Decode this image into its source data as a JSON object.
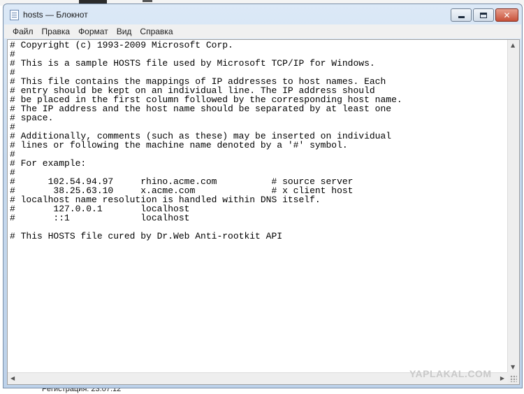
{
  "window": {
    "title": "hosts — Блокнот",
    "icon": "notepad-icon"
  },
  "caption_buttons": {
    "minimize_icon": "minimize-icon",
    "maximize_icon": "maximize-icon",
    "close_icon": "close-icon",
    "close_glyph": "✕",
    "close_color": "#c7513a"
  },
  "menu": [
    {
      "label": "Файл"
    },
    {
      "label": "Правка"
    },
    {
      "label": "Формат"
    },
    {
      "label": "Вид"
    },
    {
      "label": "Справка"
    }
  ],
  "editor": {
    "lines": [
      "# Copyright (c) 1993-2009 Microsoft Corp.",
      "#",
      "# This is a sample HOSTS file used by Microsoft TCP/IP for Windows.",
      "#",
      "# This file contains the mappings of IP addresses to host names. Each",
      "# entry should be kept on an individual line. The IP address should",
      "# be placed in the first column followed by the corresponding host name.",
      "# The IP address and the host name should be separated by at least one",
      "# space.",
      "#",
      "# Additionally, comments (such as these) may be inserted on individual",
      "# lines or following the machine name denoted by a '#' symbol.",
      "#",
      "# For example:",
      "#",
      "#      102.54.94.97     rhino.acme.com          # source server",
      "#       38.25.63.10     x.acme.com              # x client host",
      "# localhost name resolution is handled within DNS itself.",
      "#       127.0.0.1       localhost",
      "#       ::1             localhost",
      "",
      "# This HOSTS file cured by Dr.Web Anti-rootkit API"
    ]
  },
  "watermark": "YAPLAKAL.COM",
  "background": {
    "bottom_text": "Регистрация: 23.07.12"
  }
}
